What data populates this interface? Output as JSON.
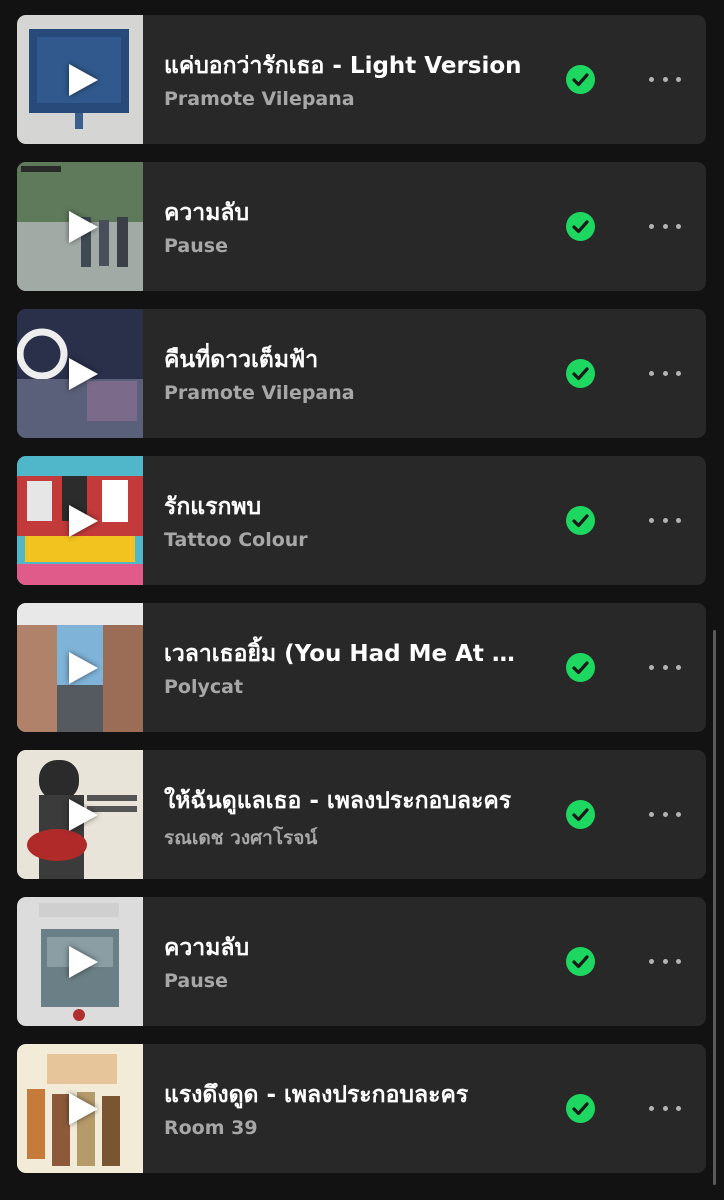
{
  "theme": {
    "background": "#121212",
    "row_background": "#282828",
    "title_color": "#ffffff",
    "artist_color": "#a7a7a7",
    "check_color": "#1ed760"
  },
  "icons": {
    "play": "play-icon",
    "downloaded": "check-circle-icon",
    "more": "more-options-icon"
  },
  "tracks": [
    {
      "title": "แค่บอกว่ารักเธอ - Light Version",
      "artist": "Pramote Vilepana",
      "downloaded": true
    },
    {
      "title": "ความลับ",
      "artist": "Pause",
      "downloaded": true
    },
    {
      "title": "คืนที่ดาวเต็มฟ้า",
      "artist": "Pramote Vilepana",
      "downloaded": true
    },
    {
      "title": "รักแรกพบ",
      "artist": "Tattoo Colour",
      "downloaded": true
    },
    {
      "title": "เวลาเธอยิ้ม (You Had Me At Hello)",
      "artist": "Polycat",
      "downloaded": true
    },
    {
      "title": "ให้ฉันดูแลเธอ - เพลงประกอบละคร",
      "artist": "รณเดช วงศาโรจน์",
      "downloaded": true
    },
    {
      "title": "ความลับ",
      "artist": "Pause",
      "downloaded": true
    },
    {
      "title": "แรงดึงดูด - เพลงประกอบละคร",
      "artist": "Room 39",
      "downloaded": true
    }
  ]
}
